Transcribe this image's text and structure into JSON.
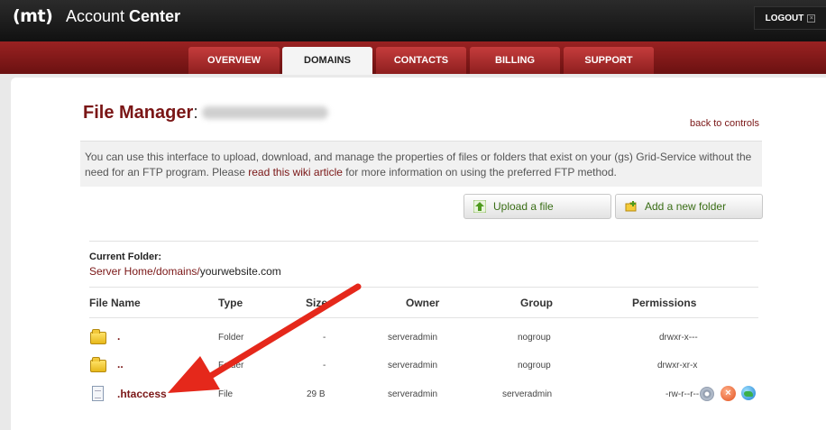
{
  "header": {
    "logo": "(mt)",
    "app_name_prefix": "Account ",
    "app_name_bold": "Center",
    "logout_label": "LOGOUT"
  },
  "nav": {
    "tabs": [
      {
        "label": "OVERVIEW"
      },
      {
        "label": "DOMAINS",
        "active": true
      },
      {
        "label": "CONTACTS"
      },
      {
        "label": "BILLING"
      },
      {
        "label": "SUPPORT"
      }
    ]
  },
  "page": {
    "title": "File Manager",
    "title_colon": ":",
    "back_link": "back to controls",
    "info_text_1": "You can use this interface to upload, download, and manage the properties of files or folders that exist on your (gs) Grid-Service without the need for an FTP program. Please ",
    "info_link": "read this wiki article",
    "info_text_2": " for more information on using the preferred FTP method."
  },
  "actions": {
    "upload_label": "Upload a file",
    "add_folder_label": "Add a new folder"
  },
  "current_folder": {
    "label": "Current Folder:",
    "path": "Server Home/domains/",
    "site": "yourwebsite.com"
  },
  "table": {
    "headers": {
      "name": "File Name",
      "type": "Type",
      "size": "Size",
      "owner": "Owner",
      "group": "Group",
      "permissions": "Permissions"
    },
    "rows": [
      {
        "name": ".",
        "type": "Folder",
        "size": "-",
        "owner": "serveradmin",
        "group": "nogroup",
        "permissions": "drwxr-x---"
      },
      {
        "name": "..",
        "type": "Folder",
        "size": "-",
        "owner": "serveradmin",
        "group": "nogroup",
        "permissions": "drwxr-xr-x"
      },
      {
        "name": ".htaccess",
        "type": "File",
        "size": "29 B",
        "owner": "serveradmin",
        "group": "serveradmin",
        "permissions": "-rw-r--r--"
      }
    ]
  },
  "colors": {
    "accent": "#7a1616",
    "nav_red": "#9a2222",
    "annotation_arrow": "#e5281b"
  },
  "icons": {
    "upload": "upload-arrow-icon",
    "add_folder": "add-folder-icon",
    "folder": "folder-icon",
    "file": "file-icon",
    "settings": "gear-icon",
    "delete": "delete-icon",
    "download": "globe-icon"
  }
}
